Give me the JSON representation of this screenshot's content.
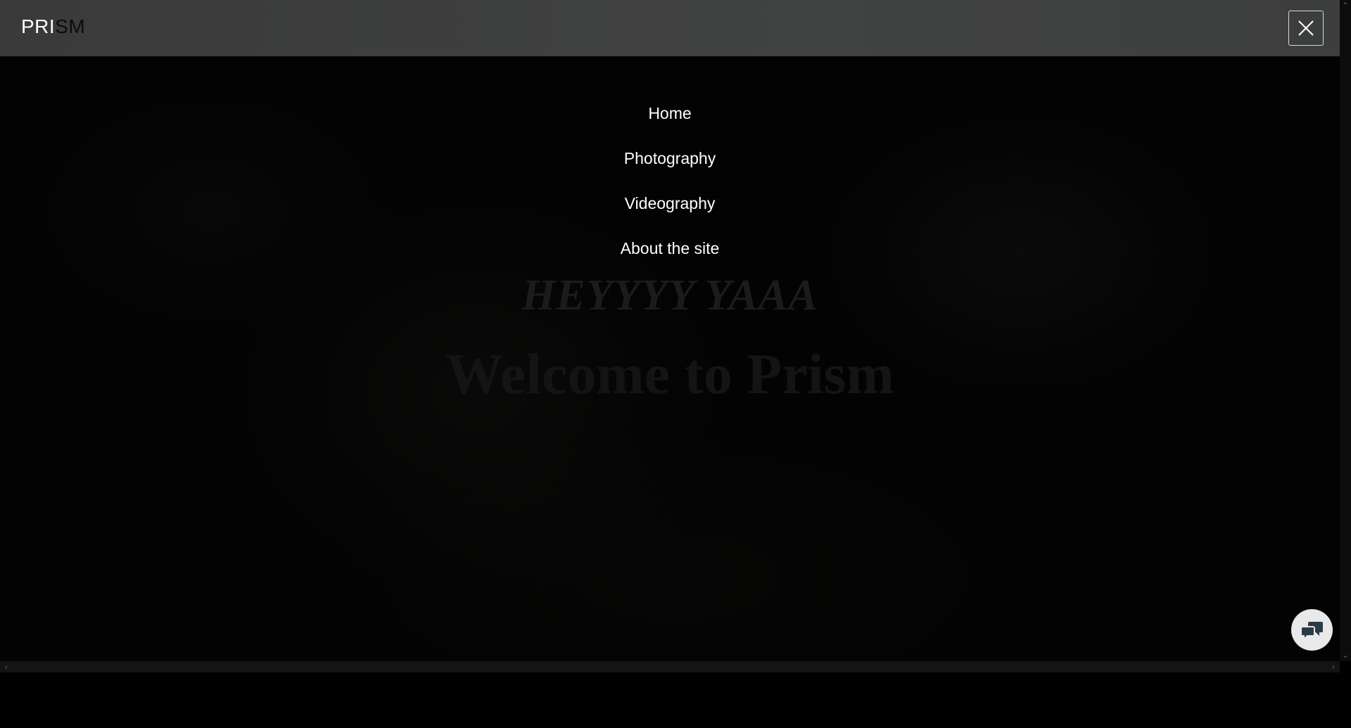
{
  "header": {
    "logo_part1": "PRI",
    "logo_part2": "SM",
    "close_icon": "close-icon"
  },
  "menu": {
    "items": [
      {
        "label": "Home"
      },
      {
        "label": "Photography"
      },
      {
        "label": "Videography"
      },
      {
        "label": "About the site"
      }
    ]
  },
  "hero": {
    "subtitle": "HEYYYY YAAA",
    "title": "Welcome to Prism"
  },
  "chat": {
    "icon": "chat-bubbles-icon"
  },
  "colors": {
    "header_bg": "#3f4040",
    "overlay": "#000000",
    "menu_text": "#ffffff"
  }
}
